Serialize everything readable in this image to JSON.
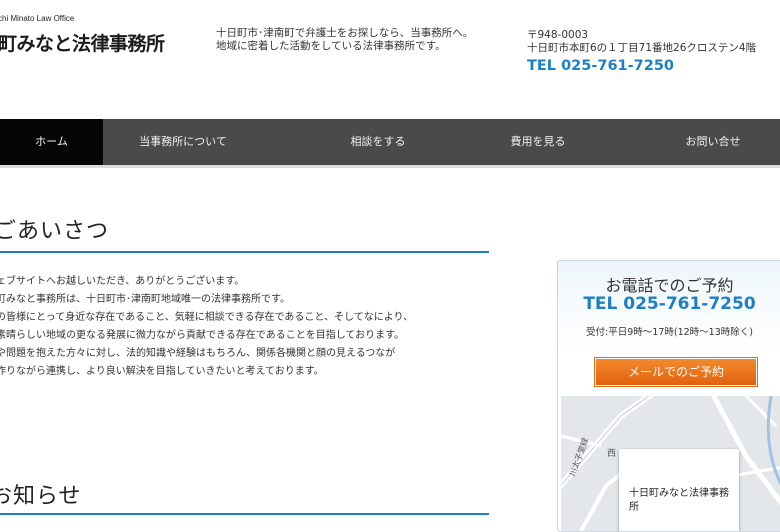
{
  "header": {
    "logo_sub": "chi Minato Law Office",
    "logo_title": "町みなと法律事務所",
    "tagline": [
      "十日町市･津南町で弁護士をお探しなら、当事務所へ。",
      "地域に密着した活動をしている法律事務所です。"
    ],
    "address": [
      "〒948-0003",
      "十日町市本町6の１丁目71番地26クロステン4階"
    ],
    "tel": "TEL 025-761-7250"
  },
  "nav": {
    "items": [
      {
        "label": "ホーム",
        "active": true
      },
      {
        "label": "当事務所について"
      },
      {
        "label": "相談をする"
      },
      {
        "label": "費用を見る"
      },
      {
        "label": "お問い合せ"
      }
    ]
  },
  "greeting": {
    "title": "ごあいさつ",
    "lines": [
      "ウェブサイトへお越しいただき、ありがとうございます。",
      "日町みなと事務所は、十日町市･津南町地域唯一の法律事務所です。",
      "域の皆様にとって身近な存在であること、気軽に相談できる存在であること、そしてなにより、",
      "、素晴らしい地域の更なる発展に微力ながら貢献できる存在であることを目指しております。",
      "みや問題を抱えた方々に対し、法的知識や経験はもちろん、関係各機関と顔の見えるつなが",
      "を作りながら連携し、より良い解決を目指していきたいと考えております。"
    ]
  },
  "news": {
    "title": "お知らせ"
  },
  "contact_box": {
    "heading": "お電話でのご予約",
    "tel": "TEL 025-761-7250",
    "hours": "受付:平日9時～17時(12時～13時除く)",
    "mail_button": "メールでのご予約",
    "map_labels": [
      "十日町みなと法律事務所",
      "西",
      "川太子堂線"
    ]
  },
  "colors": {
    "accent_blue": "#1e7fc4",
    "nav_bg": "#4a4a4a",
    "nav_active": "#050505",
    "button_orange": "#e8701a"
  }
}
